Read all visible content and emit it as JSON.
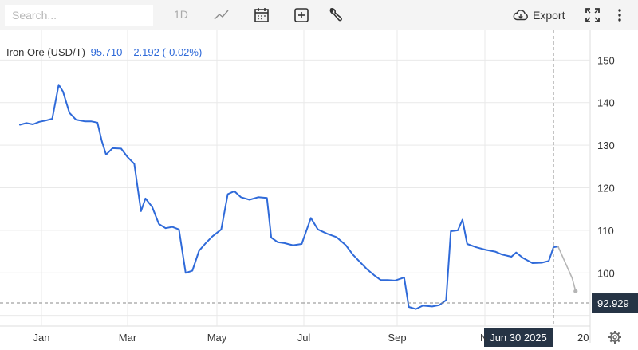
{
  "toolbar": {
    "search_placeholder": "Search...",
    "interval_label": "1D",
    "export_label": "Export",
    "icons": [
      "line-chart-icon",
      "calendar-icon",
      "add-box-icon",
      "wrench-icon",
      "cloud-download-icon",
      "fullscreen-icon",
      "more-vertical-icon"
    ]
  },
  "legend": {
    "name": "Iron Ore (USD/T)",
    "value": "95.710",
    "change": "-2.192 (-0.02%)"
  },
  "crosshair": {
    "price_label": "92.929",
    "date_label": "Jun 30 2025",
    "year_label_partial": "20",
    "month_label_partial": "N"
  },
  "chart_data": {
    "type": "line",
    "title": "",
    "xlabel": "",
    "ylabel": "",
    "x_tick_labels": [
      "Jan",
      "Mar",
      "May",
      "Jul",
      "Sep"
    ],
    "y_tick_labels": [
      "100",
      "110",
      "120",
      "130",
      "140",
      "150"
    ],
    "ylim": [
      87.5,
      157
    ],
    "xlim": [
      0,
      17.4
    ],
    "grid": true,
    "colors": {
      "series": "#2f6ad9",
      "projection": "#b5b5b5",
      "grid": "#e9e9e9"
    },
    "series": [
      {
        "values": [
          [
            0.0,
            134.8
          ],
          [
            0.3,
            135.2
          ],
          [
            0.6,
            134.9
          ],
          [
            0.9,
            135.5
          ],
          [
            1.2,
            135.8
          ],
          [
            1.5,
            136.2
          ],
          [
            1.8,
            144.2
          ],
          [
            2.0,
            142.6
          ],
          [
            2.3,
            137.6
          ],
          [
            2.6,
            136.0
          ],
          [
            3.0,
            135.6
          ],
          [
            3.3,
            135.6
          ],
          [
            3.6,
            135.3
          ],
          [
            3.8,
            131.0
          ],
          [
            4.0,
            127.8
          ],
          [
            4.3,
            129.3
          ],
          [
            4.7,
            129.2
          ],
          [
            5.0,
            127.2
          ],
          [
            5.3,
            125.6
          ],
          [
            5.6,
            114.5
          ],
          [
            5.8,
            117.5
          ],
          [
            6.1,
            115.5
          ],
          [
            6.4,
            111.5
          ],
          [
            6.7,
            110.5
          ],
          [
            7.0,
            110.8
          ],
          [
            7.3,
            110.2
          ],
          [
            7.6,
            100.0
          ],
          [
            7.9,
            100.5
          ],
          [
            8.2,
            105.2
          ],
          [
            8.5,
            107.0
          ],
          [
            8.8,
            108.6
          ],
          [
            9.2,
            110.2
          ],
          [
            9.5,
            118.5
          ],
          [
            9.8,
            119.2
          ],
          [
            10.1,
            117.8
          ],
          [
            10.5,
            117.2
          ],
          [
            10.9,
            117.8
          ],
          [
            11.3,
            117.6
          ],
          [
            11.5,
            108.3
          ],
          [
            11.8,
            107.2
          ],
          [
            12.1,
            107.0
          ],
          [
            12.5,
            106.5
          ],
          [
            12.9,
            106.8
          ],
          [
            13.3,
            112.9
          ],
          [
            13.6,
            110.2
          ],
          [
            14.0,
            109.2
          ],
          [
            14.4,
            108.4
          ],
          [
            14.8,
            106.5
          ],
          [
            15.1,
            104.3
          ],
          [
            15.4,
            102.6
          ],
          [
            15.7,
            100.9
          ],
          [
            16.0,
            99.5
          ],
          [
            16.3,
            98.3
          ],
          [
            16.6,
            98.3
          ],
          [
            16.9,
            98.2
          ],
          [
            17.3,
            98.9
          ],
          [
            17.5,
            92.0
          ],
          [
            17.8,
            91.5
          ],
          [
            18.1,
            92.3
          ],
          [
            18.5,
            92.1
          ],
          [
            18.8,
            92.4
          ],
          [
            19.1,
            93.6
          ],
          [
            19.3,
            109.8
          ],
          [
            19.6,
            110.0
          ],
          [
            19.8,
            112.5
          ],
          [
            20.0,
            106.8
          ],
          [
            20.4,
            106.0
          ],
          [
            20.8,
            105.4
          ],
          [
            21.2,
            105.0
          ],
          [
            21.5,
            104.3
          ],
          [
            21.9,
            103.8
          ],
          [
            22.1,
            104.8
          ],
          [
            22.4,
            103.5
          ],
          [
            22.8,
            102.3
          ],
          [
            23.2,
            102.4
          ],
          [
            23.5,
            102.8
          ],
          [
            23.7,
            106.0
          ],
          [
            23.9,
            106.2
          ]
        ]
      },
      {
        "values": [
          [
            23.9,
            106.2
          ],
          [
            24.5,
            98.8
          ],
          [
            24.65,
            95.7
          ]
        ]
      }
    ]
  }
}
